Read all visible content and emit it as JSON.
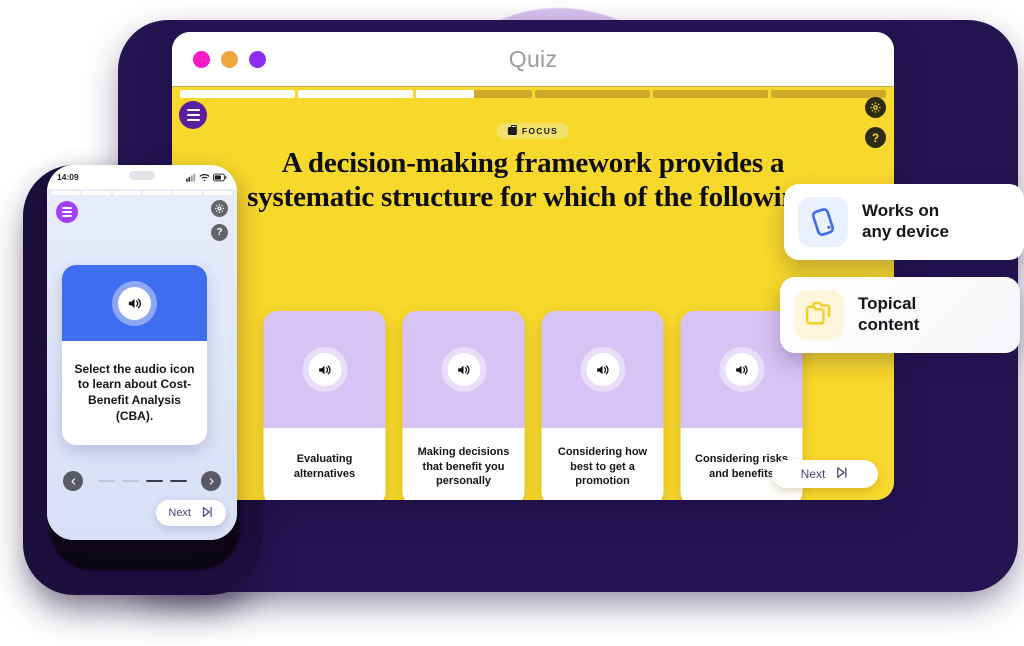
{
  "window": {
    "title": "Quiz",
    "traffic_lights": [
      {
        "name": "close",
        "color": "#fb18c6"
      },
      {
        "name": "minimize",
        "color": "#eda83d"
      },
      {
        "name": "maximize",
        "color": "#8c2ef0"
      }
    ]
  },
  "app": {
    "progress": {
      "total_segments": 6,
      "filled_segments": 2,
      "partial_segment_pct": 50
    },
    "menu_icon": "hamburger-icon",
    "settings_icon": "gear-icon",
    "help_icon": "question-mark-icon",
    "badge": {
      "label": "FOCUS",
      "icon": "briefcase-icon"
    },
    "question": "A decision-making framework provides a systematic structure for which of the following.",
    "answers": [
      {
        "label": "Evaluating alternatives",
        "icon": "speaker-icon"
      },
      {
        "label": "Making decisions that benefit you personally",
        "icon": "speaker-icon"
      },
      {
        "label": "Considering how best to get a promotion",
        "icon": "speaker-icon"
      },
      {
        "label": "Considering risks and benefits",
        "icon": "speaker-icon"
      }
    ],
    "next_label": "Next",
    "next_icon": "skip-next-icon",
    "accent_bg": "#f8d82b",
    "card_top_color": "#d8c3f5"
  },
  "phone": {
    "status": {
      "time": "14:09",
      "signal_icon": "cellular-icon",
      "wifi_icon": "wifi-icon",
      "battery_icon": "battery-icon"
    },
    "progress": {
      "total_segments": 6,
      "filled_segments": 6
    },
    "menu_icon": "hamburger-icon",
    "settings_icon": "gear-icon",
    "help_icon": "question-mark-icon",
    "card": {
      "text": "Select the audio icon to learn about Cost-Benefit Analysis (CBA).",
      "icon": "speaker-icon",
      "top_color": "#3f6df0"
    },
    "nav": {
      "prev_icon": "chevron-left-icon",
      "next_icon": "chevron-right-icon",
      "dashes": [
        false,
        false,
        true,
        true
      ]
    },
    "next_label": "Next",
    "next_btn_icon": "skip-next-icon"
  },
  "badges": [
    {
      "title_line1": "Works on",
      "title_line2": "any device",
      "icon": "mobile-phone-icon",
      "icon_color": "#3f6df0",
      "icon_bg": "#eaf0fe"
    },
    {
      "title_line1": "Topical",
      "title_line2": "content",
      "icon": "folder-icon",
      "icon_color": "#f5cf2a",
      "icon_bg": "#fdf6dc"
    }
  ]
}
